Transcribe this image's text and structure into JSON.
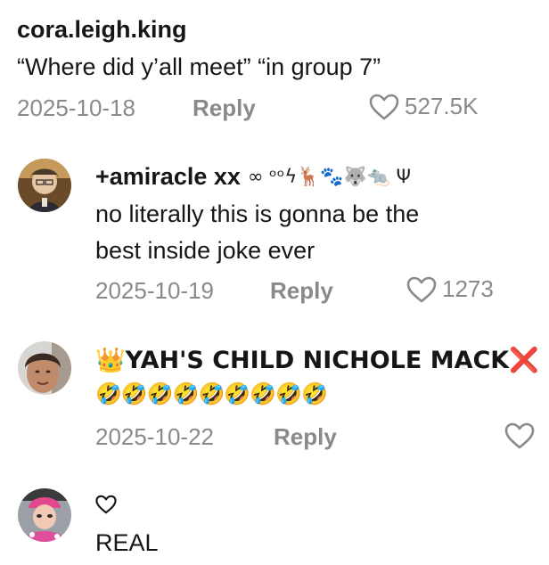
{
  "comments": [
    {
      "username": "cora.leigh.king",
      "text": "“Where did y’all meet” “in group 7”",
      "date": "2025-10-18",
      "reply_label": "Reply",
      "likes": "527.5K"
    },
    {
      "username": "+amiracle xx",
      "username_symbols": "∞ ᵒᵒϟ🦌🐾🐺🐀 Ψ",
      "text_lines": [
        "no literally this is gonna be the",
        "best inside joke ever"
      ],
      "date": "2025-10-19",
      "reply_label": "Reply",
      "likes": "1273"
    },
    {
      "username": "👑YAH'S CHILD NICHOLE MACK❌",
      "text": "🤣🤣🤣🤣🤣🤣🤣🤣🤣",
      "date": "2025-10-22",
      "reply_label": "Reply"
    },
    {
      "username_icon": "heart-outline-icon",
      "text": "REAL"
    }
  ]
}
